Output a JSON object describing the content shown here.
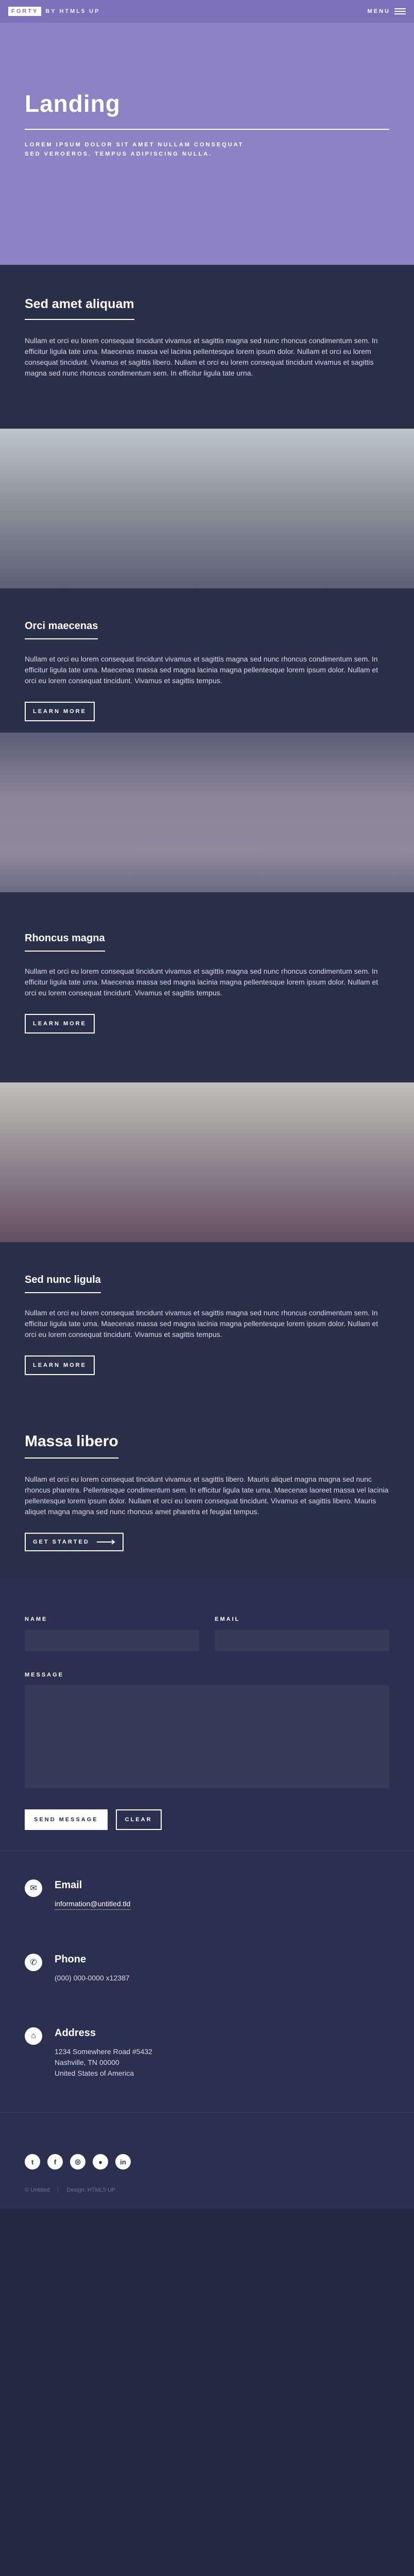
{
  "header": {
    "logo_mark": "FORTY",
    "logo_by": "BY HTML5 UP",
    "menu_label": "MENU"
  },
  "banner": {
    "title": "Landing",
    "subtitle_line1": "LOREM IPSUM DOLOR SIT AMET NULLAM CONSEQUAT",
    "subtitle_line2": "SED VEROEROS. TEMPUS ADIPISCING NULLA."
  },
  "intro": {
    "title": "Sed amet aliquam",
    "body": "Nullam et orci eu lorem consequat tincidunt vivamus et sagittis magna sed nunc rhoncus condimentum sem. In efficitur ligula tate urna. Maecenas massa vel lacinia pellentesque lorem ipsum dolor. Nullam et orci eu lorem consequat tincidunt. Vivamus et sagittis libero. Nullam et orci eu lorem consequat tincidunt vivamus et sagittis magna sed nunc rhoncus condimentum sem. In efficitur ligula tate urna."
  },
  "spotlights": [
    {
      "title": "Orci maecenas",
      "body": "Nullam et orci eu lorem consequat tincidunt vivamus et sagittis magna sed nunc rhoncus condimentum sem. In efficitur ligula tate urna. Maecenas massa sed magna lacinia magna pellentesque lorem ipsum dolor. Nullam et orci eu lorem consequat tincidunt. Vivamus et sagittis tempus.",
      "button": "LEARN MORE"
    },
    {
      "title": "Rhoncus magna",
      "body": "Nullam et orci eu lorem consequat tincidunt vivamus et sagittis magna sed nunc rhoncus condimentum sem. In efficitur ligula tate urna. Maecenas massa sed magna lacinia magna pellentesque lorem ipsum dolor. Nullam et orci eu lorem consequat tincidunt. Vivamus et sagittis tempus.",
      "button": "LEARN MORE"
    },
    {
      "title": "Sed nunc ligula",
      "body": "Nullam et orci eu lorem consequat tincidunt vivamus et sagittis magna sed nunc rhoncus condimentum sem. In efficitur ligula tate urna. Maecenas massa sed magna lacinia magna pellentesque lorem ipsum dolor. Nullam et orci eu lorem consequat tincidunt. Vivamus et sagittis tempus.",
      "button": "LEARN MORE"
    }
  ],
  "massa": {
    "title": "Massa libero",
    "body": "Nullam et orci eu lorem consequat tincidunt vivamus et sagittis libero. Mauris aliquet magna magna sed nunc rhoncus pharetra. Pellentesque condimentum sem. In efficitur ligula tate urna. Maecenas laoreet massa vel lacinia pellentesque lorem ipsum dolor. Nullam et orci eu lorem consequat tincidunt. Vivamus et sagittis libero. Mauris aliquet magna magna sed nunc rhoncus amet pharetra et feugiat tempus.",
    "button": "GET STARTED"
  },
  "form": {
    "name_label": "NAME",
    "email_label": "EMAIL",
    "message_label": "MESSAGE",
    "send_button": "SEND MESSAGE",
    "clear_button": "CLEAR"
  },
  "contact": {
    "email_title": "Email",
    "email_value": "information@untitled.tld",
    "phone_title": "Phone",
    "phone_value": "(000) 000-0000 x12387",
    "address_title": "Address",
    "address_line1": "1234 Somewhere Road #5432",
    "address_line2": "Nashville, TN 00000",
    "address_line3": "United States of America"
  },
  "footer": {
    "socials": [
      {
        "icon": "twitter-icon",
        "glyph": "t"
      },
      {
        "icon": "facebook-icon",
        "glyph": "f"
      },
      {
        "icon": "instagram-icon",
        "glyph": "◎"
      },
      {
        "icon": "github-icon",
        "glyph": "●"
      },
      {
        "icon": "linkedin-icon",
        "glyph": "in"
      }
    ],
    "copyright": "© Untitled",
    "design": "Design: HTML5 UP"
  },
  "colors": {
    "accent": "#7d70ba",
    "background": "#242943",
    "section": "#2a2f4a"
  }
}
